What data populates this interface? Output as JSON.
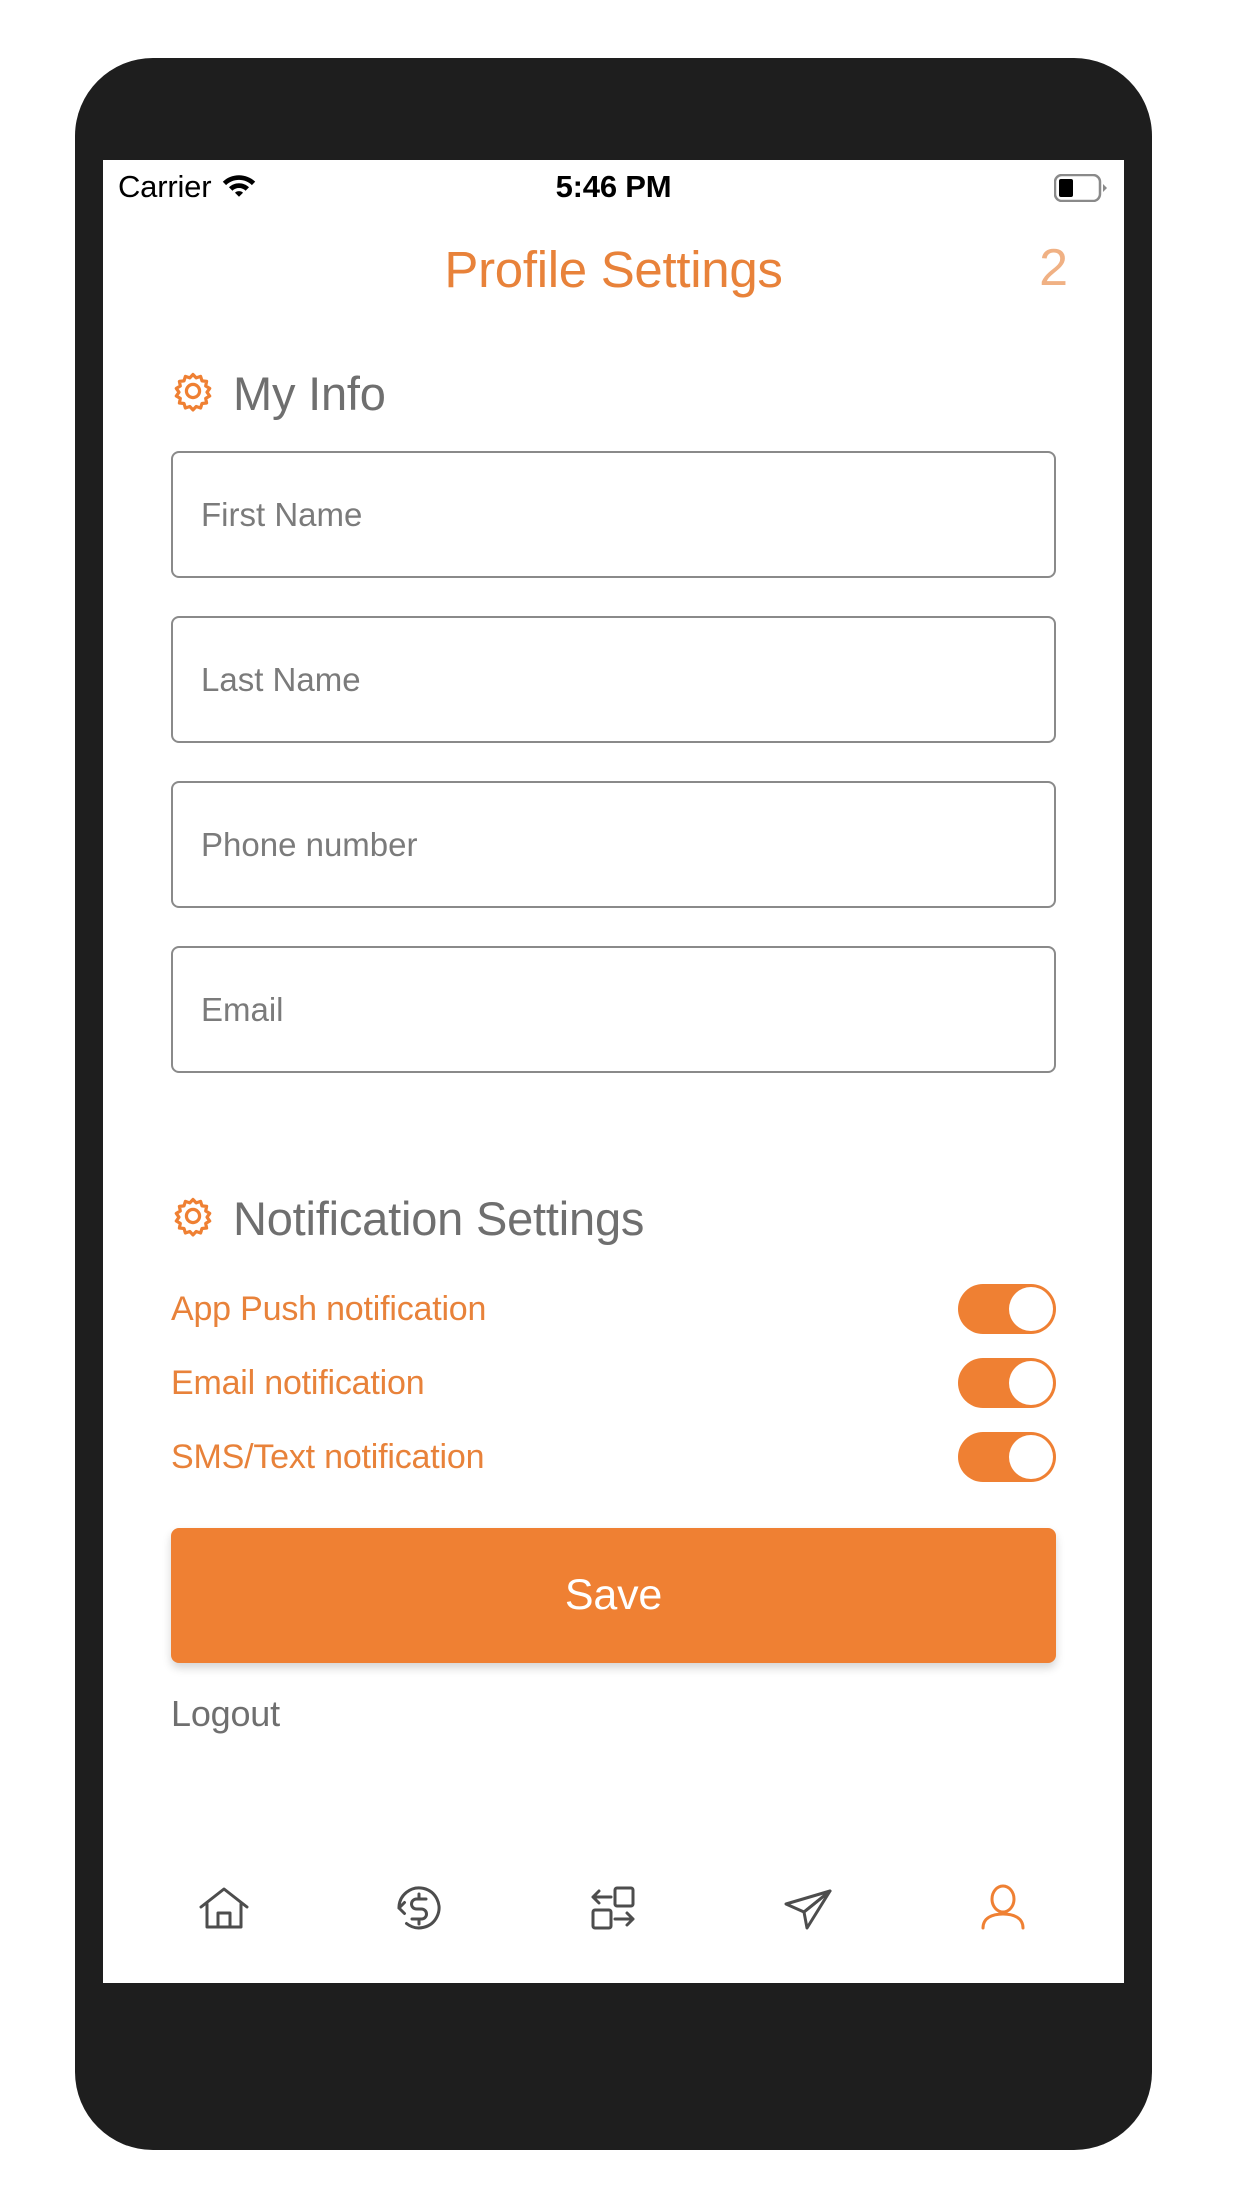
{
  "status_bar": {
    "carrier": "Carrier",
    "wifi_icon": "wifi-icon",
    "time": "5:46 PM",
    "battery_icon": "battery-icon",
    "battery_level_pct": 30
  },
  "header": {
    "title": "Profile Settings",
    "badge": "2"
  },
  "colors": {
    "accent_orange": "#e8823a",
    "button_orange": "#ef8033",
    "label_gray": "#6f6f6f",
    "field_border": "#8a8a8a",
    "placeholder_gray": "#7b7b7b",
    "bezel": "#1e1e1e"
  },
  "my_info": {
    "icon": "gear-icon",
    "title": "My Info",
    "fields": [
      {
        "name": "first-name",
        "placeholder": "First Name",
        "value": ""
      },
      {
        "name": "last-name",
        "placeholder": "Last Name",
        "value": ""
      },
      {
        "name": "phone-number",
        "placeholder": "Phone number",
        "value": ""
      },
      {
        "name": "email",
        "placeholder": "Email",
        "value": ""
      }
    ]
  },
  "notification_settings": {
    "icon": "gear-icon",
    "title": "Notification Settings",
    "toggles": [
      {
        "label": "App Push notification",
        "state": "on"
      },
      {
        "label": "Email notification",
        "state": "on"
      },
      {
        "label": "SMS/Text notification",
        "state": "on"
      }
    ]
  },
  "actions": {
    "save_label": "Save",
    "logout_label": "Logout"
  },
  "bottom_nav": {
    "items": [
      {
        "name": "home",
        "icon": "home-icon",
        "active": false
      },
      {
        "name": "refund",
        "icon": "dollar-refresh-icon",
        "active": false
      },
      {
        "name": "transfer",
        "icon": "transfer-icon",
        "active": false
      },
      {
        "name": "send",
        "icon": "paper-plane-icon",
        "active": false
      },
      {
        "name": "profile",
        "icon": "person-icon",
        "active": true
      }
    ]
  }
}
